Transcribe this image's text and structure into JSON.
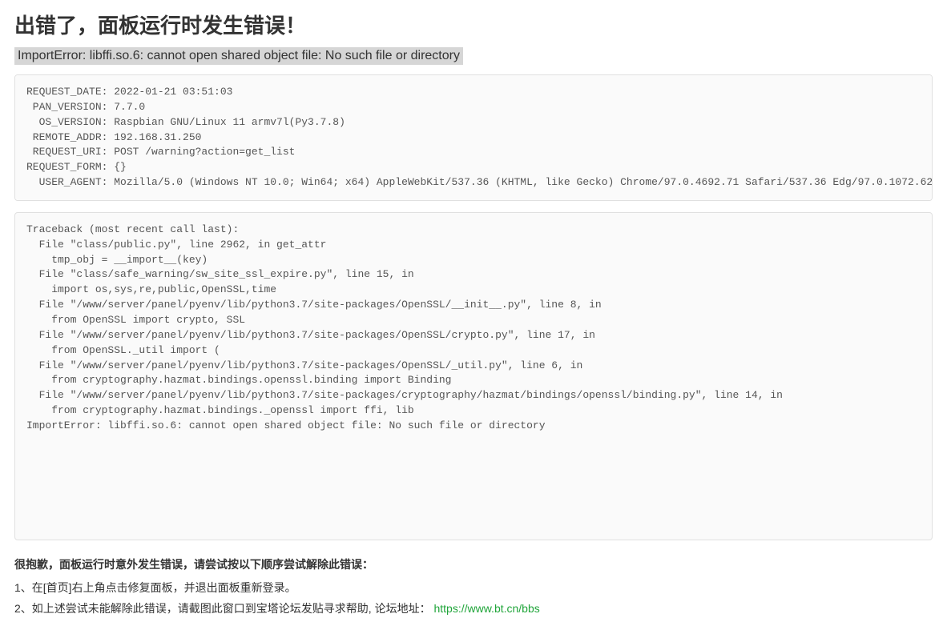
{
  "title": "出错了，面板运行时发生错误！",
  "error_message": "ImportError: libffi.so.6: cannot open shared object file: No such file or directory",
  "request_info": "REQUEST_DATE: 2022-01-21 03:51:03\n PAN_VERSION: 7.7.0\n  OS_VERSION: Raspbian GNU/Linux 11 armv7l(Py3.7.8)\n REMOTE_ADDR: 192.168.31.250\n REQUEST_URI: POST /warning?action=get_list\nREQUEST_FORM: {}\n  USER_AGENT: Mozilla/5.0 (Windows NT 10.0; Win64; x64) AppleWebKit/537.36 (KHTML, like Gecko) Chrome/97.0.4692.71 Safari/537.36 Edg/97.0.1072.62",
  "traceback": "Traceback (most recent call last):\n  File \"class/public.py\", line 2962, in get_attr\n    tmp_obj = __import__(key)\n  File \"class/safe_warning/sw_site_ssl_expire.py\", line 15, in \n    import os,sys,re,public,OpenSSL,time\n  File \"/www/server/panel/pyenv/lib/python3.7/site-packages/OpenSSL/__init__.py\", line 8, in \n    from OpenSSL import crypto, SSL\n  File \"/www/server/panel/pyenv/lib/python3.7/site-packages/OpenSSL/crypto.py\", line 17, in \n    from OpenSSL._util import (\n  File \"/www/server/panel/pyenv/lib/python3.7/site-packages/OpenSSL/_util.py\", line 6, in \n    from cryptography.hazmat.bindings.openssl.binding import Binding\n  File \"/www/server/panel/pyenv/lib/python3.7/site-packages/cryptography/hazmat/bindings/openssl/binding.py\", line 14, in \n    from cryptography.hazmat.bindings._openssl import ffi, lib\nImportError: libffi.so.6: cannot open shared object file: No such file or directory",
  "help": {
    "heading": "很抱歉，面板运行时意外发生错误，请尝试按以下顺序尝试解除此错误：",
    "step1": "1、在[首页]右上角点击修复面板，并退出面板重新登录。",
    "step2_prefix": "2、如上述尝试未能解除此错误，请截图此窗口到宝塔论坛发贴寻求帮助, 论坛地址：",
    "link_text": "https://www.bt.cn/bbs",
    "link_href": "https://www.bt.cn/bbs"
  }
}
